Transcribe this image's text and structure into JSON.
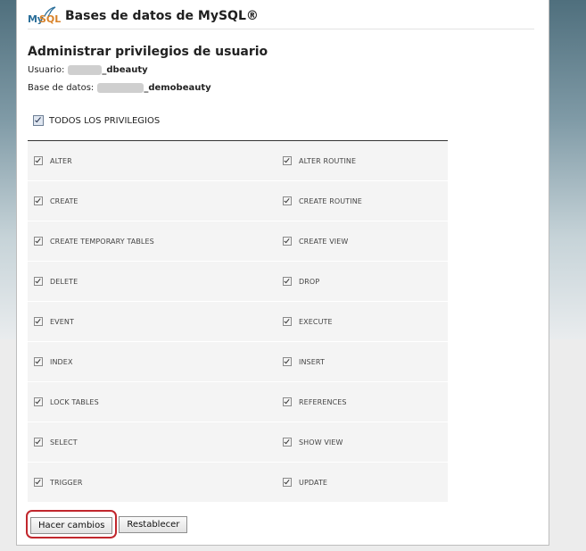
{
  "app": {
    "logo_my": "My",
    "logo_sql": "SQL",
    "title": "Bases de datos de MySQL®"
  },
  "page": {
    "title": "Administrar privilegios de usuario",
    "user_label": "Usuario:",
    "user_value": "_dbeauty",
    "db_label": "Base de datos:",
    "db_value": "_demobeauty"
  },
  "all_privileges": {
    "label": "TODOS LOS PRIVILEGIOS",
    "checked": true
  },
  "privileges": [
    [
      "ALTER",
      "ALTER ROUTINE"
    ],
    [
      "CREATE",
      "CREATE ROUTINE"
    ],
    [
      "CREATE TEMPORARY TABLES",
      "CREATE VIEW"
    ],
    [
      "DELETE",
      "DROP"
    ],
    [
      "EVENT",
      "EXECUTE"
    ],
    [
      "INDEX",
      "INSERT"
    ],
    [
      "LOCK TABLES",
      "REFERENCES"
    ],
    [
      "SELECT",
      "SHOW VIEW"
    ],
    [
      "TRIGGER",
      "UPDATE"
    ]
  ],
  "buttons": {
    "apply": "Hacer cambios",
    "reset": "Restablecer"
  },
  "colors": {
    "highlight": "#c1272d",
    "logo_blue": "#2b6f9a",
    "logo_orange": "#d9832a"
  }
}
